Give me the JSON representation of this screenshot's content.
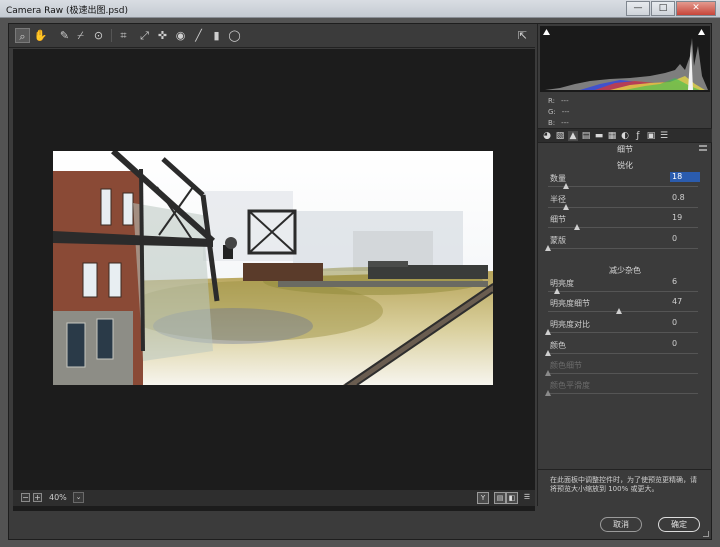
{
  "window": {
    "title": "Camera Raw (极速出图.psd)",
    "minimize": "—",
    "maximize": "□",
    "close": "✕"
  },
  "toolbar": {
    "tools": [
      "zoom-icon",
      "hand-icon",
      "white-balance-icon",
      "color-sampler-icon",
      "target-adjust-icon",
      "crop-icon",
      "straighten-icon",
      "spot-removal-icon",
      "red-eye-icon",
      "adjustment-brush-icon",
      "graduated-filter-icon",
      "radial-filter-icon"
    ],
    "open_preferences": "⇱"
  },
  "bottombar": {
    "zoom_out": "−",
    "zoom_in": "+",
    "zoom_level": "40%",
    "zoom_dropdown": "⌄",
    "view_y": "Y",
    "before_after": "▤",
    "toggle": "◧",
    "settings": "☰"
  },
  "histogram": {
    "r_label": "R:",
    "r_value": "---",
    "g_label": "G:",
    "g_value": "---",
    "b_label": "B:",
    "b_value": "---"
  },
  "panel": {
    "title": "细节",
    "sharpening": {
      "title": "锐化",
      "sliders": [
        {
          "label": "数量",
          "value": "18",
          "percent": 0.12,
          "selected": true
        },
        {
          "label": "半径",
          "value": "0.8",
          "percent": 0.12
        },
        {
          "label": "细节",
          "value": "19",
          "percent": 0.19
        },
        {
          "label": "蒙版",
          "value": "0",
          "percent": 0.0
        }
      ]
    },
    "noise_reduction": {
      "title": "减少杂色",
      "sliders": [
        {
          "label": "明亮度",
          "value": "6",
          "percent": 0.06
        },
        {
          "label": "明亮度细节",
          "value": "47",
          "percent": 0.47
        },
        {
          "label": "明亮度对比",
          "value": "0",
          "percent": 0.0
        },
        {
          "label": "颜色",
          "value": "0",
          "percent": 0.0
        },
        {
          "label": "颜色细节",
          "value": "",
          "percent": 0.0,
          "disabled": true
        },
        {
          "label": "颜色平滑度",
          "value": "",
          "percent": 0.0,
          "disabled": true
        }
      ]
    },
    "note": "在此面板中调整控件时，为了使预览更精确，请将预览大小缩放到 100% 或更大。"
  },
  "buttons": {
    "cancel": "取消",
    "ok": "确定"
  }
}
